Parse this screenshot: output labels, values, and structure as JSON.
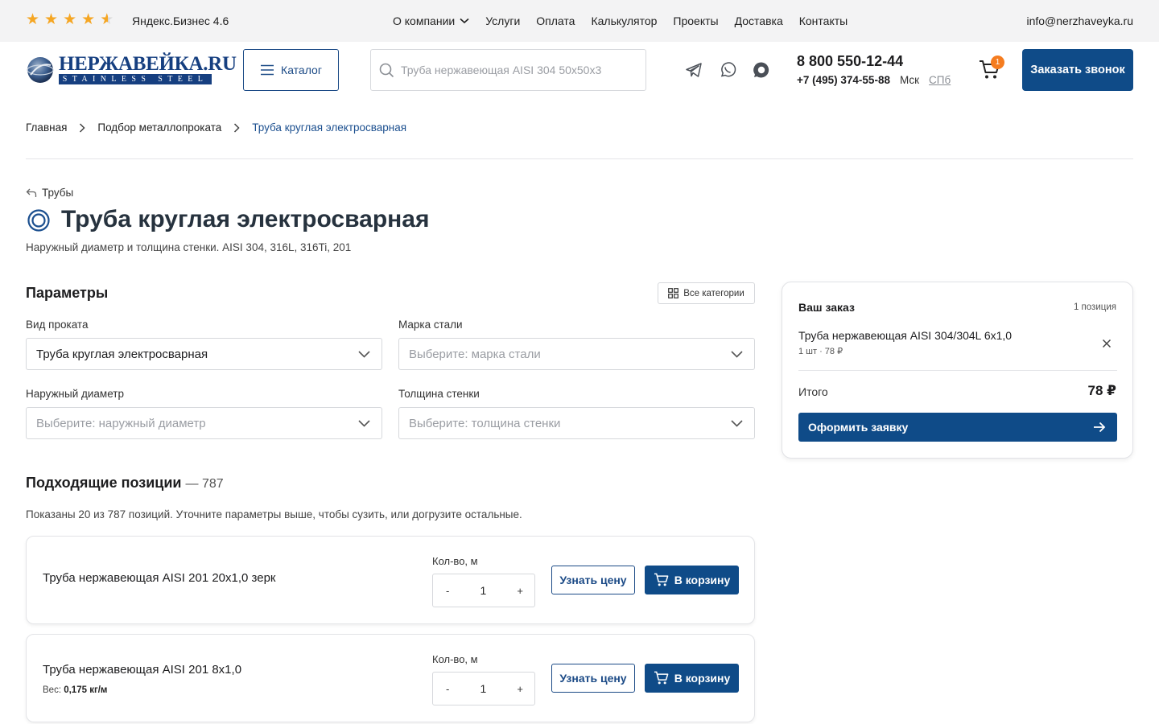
{
  "topbar": {
    "rating_text": "Яндекс.Бизнес 4.6",
    "nav": [
      {
        "label": "О компании",
        "has_dropdown": true
      },
      {
        "label": "Услуги"
      },
      {
        "label": "Оплата"
      },
      {
        "label": "Калькулятор"
      },
      {
        "label": "Проекты"
      },
      {
        "label": "Доставка"
      },
      {
        "label": "Контакты"
      }
    ],
    "email": "info@nerzhaveyka.ru",
    "star_color": "#f5a623"
  },
  "header": {
    "logo_name": "НЕРЖАВЕЙКА.RU",
    "logo_sub": "STAINLESS STEEL",
    "catalog_label": "Каталог",
    "search_placeholder": "Труба нержавеющая AISI 304 50х50х3",
    "messenger_icons": [
      "telegram-icon",
      "whatsapp-icon",
      "max-messenger-icon"
    ],
    "phone_main": "8 800 550-12-44",
    "phone_secondary": "+7 (495) 374-55-88",
    "city_active": "Мск",
    "city_alt": "СПб",
    "cart_count": "1",
    "callback_label": "Заказать звонок",
    "brand_color": "#0f4b88",
    "badge_color": "#f57c1f"
  },
  "breadcrumb": {
    "items": [
      "Главная",
      "Подбор металлопроката",
      "Труба круглая электросварная"
    ]
  },
  "page": {
    "back_label": "Трубы",
    "title": "Труба круглая электросварная",
    "subtitle": "Наружный диаметр и толщина стенки. AISI 304, 316L, 316Ti, 201"
  },
  "params": {
    "title": "Параметры",
    "all_categories_label": "Все категории",
    "fields": [
      {
        "label": "Вид проката",
        "value": "Труба круглая электросварная",
        "placeholder": ""
      },
      {
        "label": "Марка стали",
        "value": "",
        "placeholder": "Выберите: марка стали"
      },
      {
        "label": "Наружный диаметр",
        "value": "",
        "placeholder": "Выберите: наружный диаметр"
      },
      {
        "label": "Толщина стенки",
        "value": "",
        "placeholder": "Выберите: толщина стенки"
      }
    ]
  },
  "results": {
    "title": "Подходящие позиции",
    "count_text": "— 787",
    "note": "Показаны 20 из 787 позиций. Уточните параметры выше, чтобы сузить, или догрузите остальные.",
    "qty_label": "Кол-во, м",
    "price_label": "Узнать цену",
    "cart_label": "В корзину",
    "items": [
      {
        "name": "Труба нержавеющая AISI 201 20х1,0 зерк",
        "weight_label": "",
        "weight": "",
        "qty": "1"
      },
      {
        "name": "Труба нержавеющая AISI 201 8х1,0",
        "weight_label": "Вес:",
        "weight": "0,175 кг/м",
        "qty": "1"
      }
    ]
  },
  "order": {
    "title": "Ваш заказ",
    "count": "1 позиция",
    "item_name": "Труба нержавеющая AISI 304/304L 6х1,0",
    "item_meta": "1 шт · 78 ₽",
    "total_label": "Итого",
    "total_value": "78 ₽",
    "checkout_label": "Оформить заявку"
  }
}
